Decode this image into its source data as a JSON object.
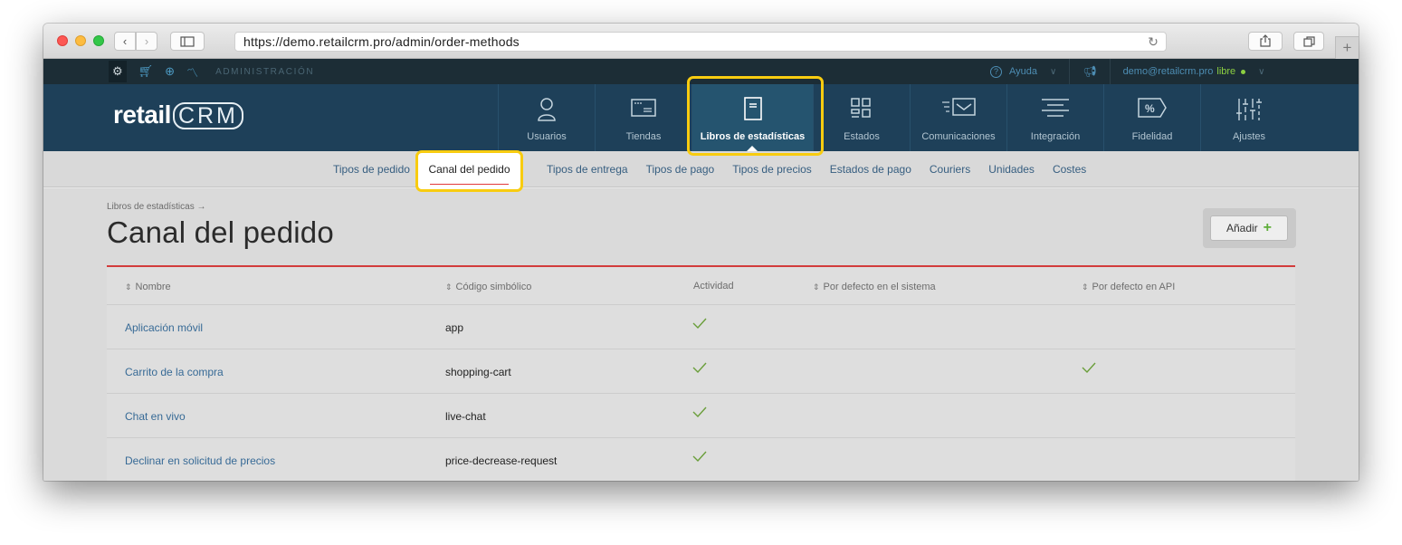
{
  "browser": {
    "url": "https://demo.retailcrm.pro/admin/order-methods"
  },
  "adminbar": {
    "section_label": "ADMINISTRACIÓN",
    "help_label": "Ayuda",
    "user_email": "demo@retailcrm.pro",
    "plan_label": "libre"
  },
  "logo": {
    "retail": "retail",
    "crm": "CRM"
  },
  "mainnav": {
    "items": [
      {
        "label": "Usuarios",
        "icon": "user-icon"
      },
      {
        "label": "Tiendas",
        "icon": "store-icon"
      },
      {
        "label": "Libros de estadísticas",
        "icon": "book-icon"
      },
      {
        "label": "Estados",
        "icon": "status-grid-icon"
      },
      {
        "label": "Comunicaciones",
        "icon": "mail-icon"
      },
      {
        "label": "Integración",
        "icon": "integration-icon"
      },
      {
        "label": "Fidelidad",
        "icon": "discount-tag-icon"
      },
      {
        "label": "Ajustes",
        "icon": "sliders-icon"
      }
    ],
    "active_index": 2
  },
  "subnav": {
    "items": [
      "Tipos de pedido",
      "Canal del pedido",
      "Tipos de entrega",
      "Tipos de pago",
      "Tipos de precios",
      "Estados de pago",
      "Couriers",
      "Unidades",
      "Costes"
    ],
    "active": "Canal del pedido"
  },
  "page": {
    "breadcrumb": "Libros de estadísticas →",
    "title": "Canal del pedido",
    "add_label": "Añadir"
  },
  "table": {
    "headers": [
      "Nombre",
      "Código simbólico",
      "Actividad",
      "Por defecto en el sistema",
      "Por defecto en API"
    ],
    "rows": [
      {
        "name": "Aplicación móvil",
        "code": "app",
        "active": true,
        "default_system": false,
        "default_api": false
      },
      {
        "name": "Carrito de la compra",
        "code": "shopping-cart",
        "active": true,
        "default_system": false,
        "default_api": true
      },
      {
        "name": "Chat en vivo",
        "code": "live-chat",
        "active": true,
        "default_system": false,
        "default_api": false
      },
      {
        "name": "Declinar en solicitud de precios",
        "code": "price-decrease-request",
        "active": true,
        "default_system": false,
        "default_api": false
      }
    ]
  },
  "colors": {
    "accent": "#f8cc10",
    "nav_bg": "#1e4059",
    "link": "#376a96",
    "check": "#6a9e3a",
    "divider": "#d23c3c"
  }
}
